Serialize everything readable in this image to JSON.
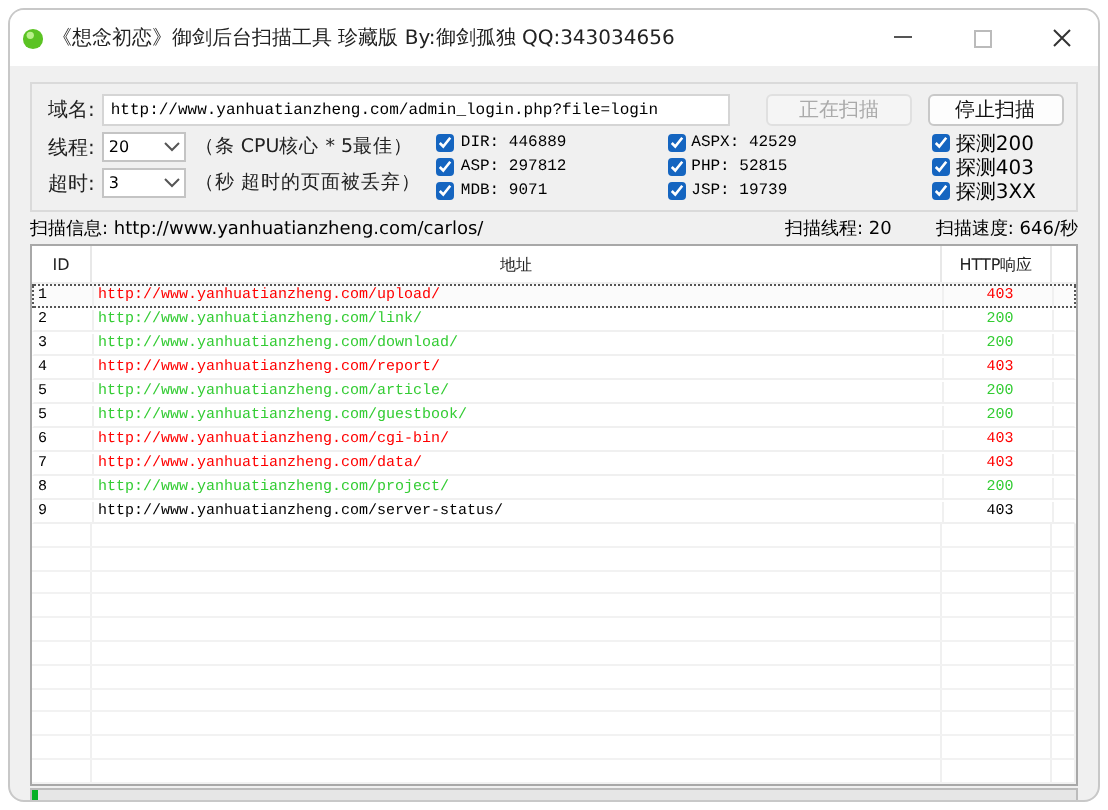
{
  "window": {
    "title": "《想念初恋》御剑后台扫描工具 珍藏版 By:御剑孤独 QQ:343034656"
  },
  "form": {
    "domain": {
      "label": "域名:",
      "value": "http://www.yanhuatianzheng.com/admin_login.php?file=login"
    },
    "threads": {
      "label": "线程:",
      "value": "20",
      "hint": "（条 CPU核心 * 5最佳）"
    },
    "timeout": {
      "label": "超时:",
      "value": "3",
      "hint": "（秒 超时的页面被丢弃）"
    },
    "buttons": [
      {
        "label": "正在扫描",
        "disabled": true
      },
      {
        "label": "停止扫描",
        "disabled": false
      }
    ],
    "checkbox_columns": [
      [
        {
          "label": "DIR: 446889",
          "checked": true
        },
        {
          "label": "ASP: 297812",
          "checked": true
        },
        {
          "label": "MDB: 9071",
          "checked": true
        }
      ],
      [
        {
          "label": "ASPX: 42529",
          "checked": true
        },
        {
          "label": "PHP: 52815",
          "checked": true
        },
        {
          "label": "JSP: 19739",
          "checked": true
        }
      ],
      [
        {
          "label": "探测200",
          "checked": true
        },
        {
          "label": "探测403",
          "checked": true
        },
        {
          "label": "探测3XX",
          "checked": true
        }
      ]
    ]
  },
  "status": {
    "info": "扫描信息: http://www.yanhuatianzheng.com/carlos/",
    "threads": "扫描线程: 20",
    "speed": "扫描速度: 646/秒"
  },
  "table": {
    "columns": [
      "ID",
      "地址",
      "HTTP响应"
    ],
    "rows": [
      {
        "id": "1",
        "url": "http://www.yanhuatianzheng.com/upload/",
        "code": "403",
        "color": "#ff0000",
        "selected": true
      },
      {
        "id": "2",
        "url": "http://www.yanhuatianzheng.com/link/",
        "code": "200",
        "color": "#33cc33",
        "selected": false
      },
      {
        "id": "3",
        "url": "http://www.yanhuatianzheng.com/download/",
        "code": "200",
        "color": "#33cc33",
        "selected": false
      },
      {
        "id": "4",
        "url": "http://www.yanhuatianzheng.com/report/",
        "code": "403",
        "color": "#ff0000",
        "selected": false
      },
      {
        "id": "5",
        "url": "http://www.yanhuatianzheng.com/article/",
        "code": "200",
        "color": "#33cc33",
        "selected": false
      },
      {
        "id": "5",
        "url": "http://www.yanhuatianzheng.com/guestbook/",
        "code": "200",
        "color": "#33cc33",
        "selected": false
      },
      {
        "id": "6",
        "url": "http://www.yanhuatianzheng.com/cgi-bin/",
        "code": "403",
        "color": "#ff0000",
        "selected": false
      },
      {
        "id": "7",
        "url": "http://www.yanhuatianzheng.com/data/",
        "code": "403",
        "color": "#ff0000",
        "selected": false
      },
      {
        "id": "8",
        "url": "http://www.yanhuatianzheng.com/project/",
        "code": "200",
        "color": "#33cc33",
        "selected": false
      },
      {
        "id": "9",
        "url": "http://www.yanhuatianzheng.com/server-status/",
        "code": "403",
        "color": "#000000",
        "selected": false
      }
    ]
  },
  "progress": {
    "level": 0.006
  }
}
